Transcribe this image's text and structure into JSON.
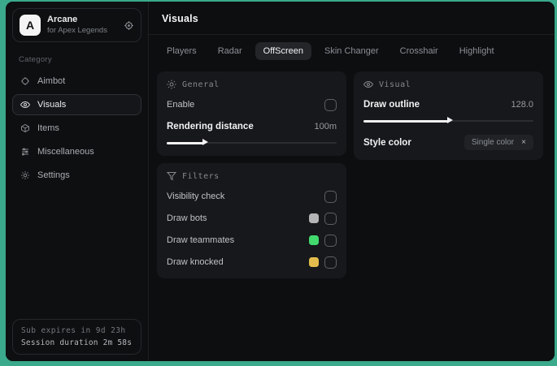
{
  "brand": {
    "logo_letter": "A",
    "title": "Arcane",
    "subtitle": "for Apex Legends"
  },
  "sidebar": {
    "category_label": "Category",
    "items": [
      {
        "label": "Aimbot",
        "icon": "crosshair-icon"
      },
      {
        "label": "Visuals",
        "icon": "eye-icon",
        "active": true
      },
      {
        "label": "Items",
        "icon": "cube-icon"
      },
      {
        "label": "Miscellaneous",
        "icon": "sliders-icon"
      },
      {
        "label": "Settings",
        "icon": "gear-icon"
      }
    ],
    "footer": {
      "line1": "Sub expires in 9d 23h",
      "line2": "Session duration 2m 58s"
    }
  },
  "header": {
    "title": "Visuals"
  },
  "tabs": [
    {
      "label": "Players"
    },
    {
      "label": "Radar"
    },
    {
      "label": "OffScreen",
      "active": true
    },
    {
      "label": "Skin Changer"
    },
    {
      "label": "Crosshair"
    },
    {
      "label": "Highlight"
    }
  ],
  "panels": {
    "general": {
      "title": "General",
      "enable_label": "Enable",
      "rendering_label": "Rendering distance",
      "rendering_value": "100m",
      "rendering_fill_percent": "22%"
    },
    "visual": {
      "title": "Visual",
      "outline_label": "Draw outline",
      "outline_value": "128.0",
      "outline_fill_percent": "50%",
      "style_label": "Style color",
      "style_value": "Single color",
      "style_clear": "×"
    },
    "filters": {
      "title": "Filters",
      "rows": [
        {
          "label": "Visibility check",
          "swatch": null
        },
        {
          "label": "Draw bots",
          "swatch": "#b4b4b6"
        },
        {
          "label": "Draw teammates",
          "swatch": "#42d96e"
        },
        {
          "label": "Draw knocked",
          "swatch": "#e2bd4d"
        }
      ]
    }
  },
  "colors": {
    "desktop_background": "#3aa98c",
    "window_background": "#0c0d0f",
    "panel_background": "#17181b",
    "swatch_gray": "#b4b4b6",
    "swatch_green": "#42d96e",
    "swatch_yellow": "#e2bd4d"
  }
}
